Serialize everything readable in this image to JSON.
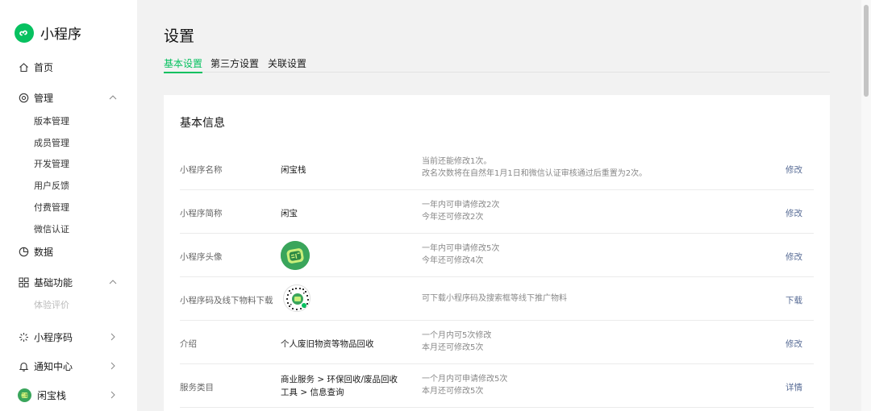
{
  "brand": {
    "title": "小程序",
    "icon": "miniprogram-logo-icon",
    "color": "#07c160"
  },
  "sidebar": {
    "home": {
      "label": "首页",
      "icon": "home-icon"
    },
    "manage": {
      "label": "管理",
      "icon": "manage-icon",
      "children": [
        "版本管理",
        "成员管理",
        "开发管理",
        "用户反馈",
        "付费管理",
        "微信认证"
      ]
    },
    "data": {
      "label": "数据",
      "icon": "pie-chart-icon"
    },
    "basic": {
      "label": "基础功能",
      "icon": "grid-icon",
      "children": [
        "体验评价"
      ]
    },
    "qrcode": {
      "label": "小程序码",
      "icon": "sun-icon"
    },
    "notice": {
      "label": "通知中心",
      "icon": "bell-icon"
    },
    "account": {
      "label": "闲宝栈",
      "icon": "avatar-icon"
    }
  },
  "page": {
    "title": "设置",
    "tabs": [
      "基本设置",
      "第三方设置",
      "关联设置"
    ],
    "active_tab": "基本设置"
  },
  "card": {
    "title": "基本信息",
    "rows": [
      {
        "label": "小程序名称",
        "value": "闲宝栈",
        "note": [
          "当前还能修改1次。",
          "改名次数将在自然年1月1日和微信认证审核通过后重置为2次。"
        ],
        "action": "修改"
      },
      {
        "label": "小程序简称",
        "value": "闲宝",
        "note": [
          "一年内可申请修改2次",
          "今年还可修改2次"
        ],
        "action": "修改"
      },
      {
        "label": "小程序头像",
        "value": "",
        "note": [
          "一年内可申请修改5次",
          "今年还可修改4次"
        ],
        "action": "修改"
      },
      {
        "label": "小程序码及线下物料下载",
        "value": "",
        "note": [
          "可下载小程序码及搜索框等线下推广物料"
        ],
        "action": "下载"
      },
      {
        "label": "介绍",
        "value": "个人废旧物资等物品回收",
        "note": [
          "一个月内可5次修改",
          "本月还可修改5次"
        ],
        "action": "修改"
      },
      {
        "label": "服务类目",
        "value": [
          "商业服务 > 环保回收/废品回收",
          "工具 > 信息查询"
        ],
        "note": [
          "一个月内可申请修改5次",
          "本月还可修改5次"
        ],
        "action": "详情"
      }
    ]
  },
  "colors": {
    "accent": "#07c160",
    "link": "#576b95"
  }
}
